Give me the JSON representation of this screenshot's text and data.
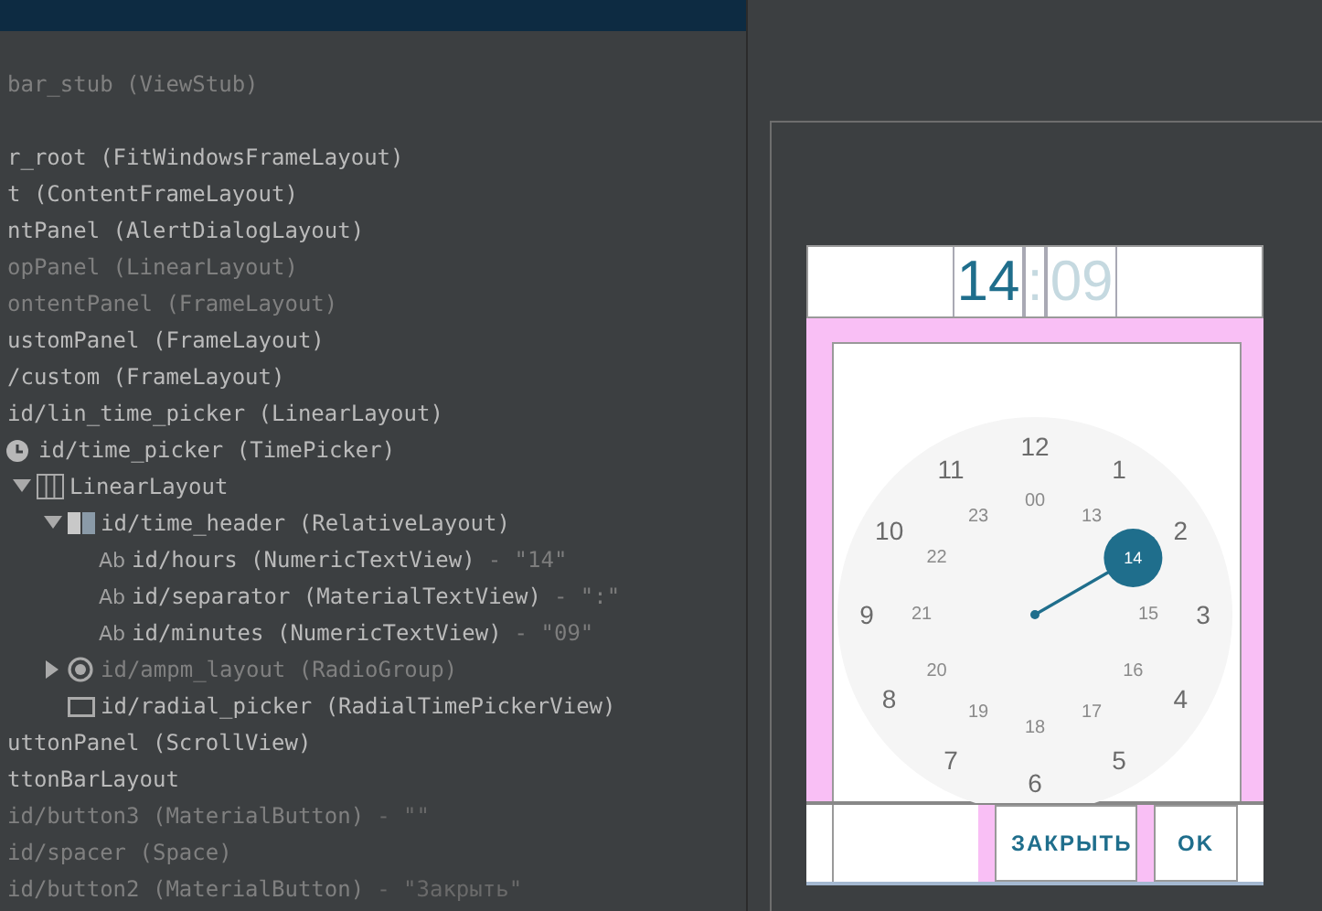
{
  "tree": [
    {
      "text": "bar_stub (ViewStub)",
      "visible": false
    },
    {
      "text": "r_root (FitWindowsFrameLayout)",
      "visible": true
    },
    {
      "text": "t (ContentFrameLayout)",
      "visible": true
    },
    {
      "text": "ntPanel (AlertDialogLayout)",
      "visible": true
    },
    {
      "text": "opPanel (LinearLayout)",
      "visible": false
    },
    {
      "text": "ontentPanel (FrameLayout)",
      "visible": false
    },
    {
      "text": "ustomPanel (FrameLayout)",
      "visible": true
    },
    {
      "text": "/custom (FrameLayout)",
      "visible": true
    },
    {
      "text": "id/lin_time_picker (LinearLayout)",
      "visible": true,
      "children": [
        {
          "text": "id/time_picker (TimePicker)",
          "visible": true,
          "kind": "clock",
          "children": [
            {
              "text": "LinearLayout",
              "visible": true,
              "kind": "linear",
              "expanded": true,
              "children": [
                {
                  "text": "id/time_header (RelativeLayout)",
                  "visible": true,
                  "kind": "relative",
                  "expanded": true,
                  "children": [
                    {
                      "text": "id/hours (NumericTextView)",
                      "visible": true,
                      "kind": "text",
                      "badge": "Ab",
                      "value": "- \"14\""
                    },
                    {
                      "text": "id/separator (MaterialTextView)",
                      "visible": true,
                      "kind": "text",
                      "badge": "Ab",
                      "value": "- \":\""
                    },
                    {
                      "text": "id/minutes (NumericTextView)",
                      "visible": true,
                      "kind": "text",
                      "badge": "Ab",
                      "value": "- \"09\""
                    }
                  ]
                },
                {
                  "text": "id/ampm_layout (RadioGroup)",
                  "visible": false,
                  "kind": "radio",
                  "expanded": false
                },
                {
                  "text": "id/radial_picker (RadialTimePickerView)",
                  "visible": true,
                  "kind": "view"
                }
              ]
            }
          ]
        }
      ]
    },
    {
      "text": "uttonPanel (ScrollView)",
      "visible": true
    },
    {
      "text": "ttonBarLayout",
      "visible": true
    },
    {
      "text": "id/button3 (MaterialButton)",
      "visible": false,
      "value": "- \"\""
    },
    {
      "text": "id/spacer (Space)",
      "visible": false
    },
    {
      "text": "id/button2 (MaterialButton)",
      "visible": false,
      "value": "- \"Закрыть\""
    }
  ],
  "preview": {
    "header": [
      {
        "text": "14",
        "selected": true
      },
      {
        "text": ":",
        "selected": false
      },
      {
        "text": "09",
        "selected": false
      }
    ],
    "clock": {
      "outer": [
        {
          "text": "12",
          "selected": false
        },
        {
          "text": "1",
          "selected": false
        },
        {
          "text": "2",
          "selected": false
        },
        {
          "text": "3",
          "selected": false
        },
        {
          "text": "4",
          "selected": false
        },
        {
          "text": "5",
          "selected": false
        },
        {
          "text": "6",
          "selected": false
        },
        {
          "text": "7",
          "selected": false
        },
        {
          "text": "8",
          "selected": false
        },
        {
          "text": "9",
          "selected": false
        },
        {
          "text": "10",
          "selected": false
        },
        {
          "text": "11",
          "selected": false
        }
      ],
      "inner": [
        {
          "text": "00",
          "selected": false
        },
        {
          "text": "13",
          "selected": false
        },
        {
          "text": "14",
          "selected": true
        },
        {
          "text": "15",
          "selected": false
        },
        {
          "text": "16",
          "selected": false
        },
        {
          "text": "17",
          "selected": false
        },
        {
          "text": "18",
          "selected": false
        },
        {
          "text": "19",
          "selected": false
        },
        {
          "text": "20",
          "selected": false
        },
        {
          "text": "21",
          "selected": false
        },
        {
          "text": "22",
          "selected": false
        },
        {
          "text": "23",
          "selected": false
        }
      ]
    },
    "buttons": [
      "ЗАКРЫТЬ",
      "OK"
    ]
  }
}
